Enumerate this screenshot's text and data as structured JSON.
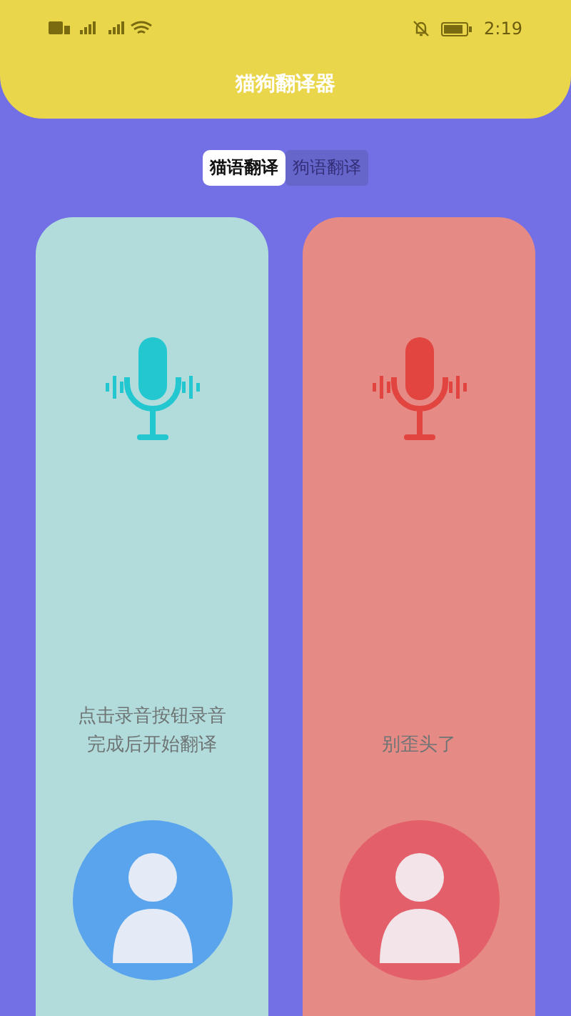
{
  "status_bar": {
    "time": "2:19"
  },
  "header": {
    "title": "猫狗翻译器"
  },
  "tabs": [
    {
      "label": "猫语翻译",
      "selected": true
    },
    {
      "label": "狗语翻译",
      "selected": false
    }
  ],
  "cards": [
    {
      "color": "#22c7d0",
      "hint_lines": [
        "点击录音按钮录音",
        "完成后开始翻译"
      ]
    },
    {
      "color": "#e2453f",
      "hint_lines": [
        "别歪头了"
      ]
    }
  ]
}
